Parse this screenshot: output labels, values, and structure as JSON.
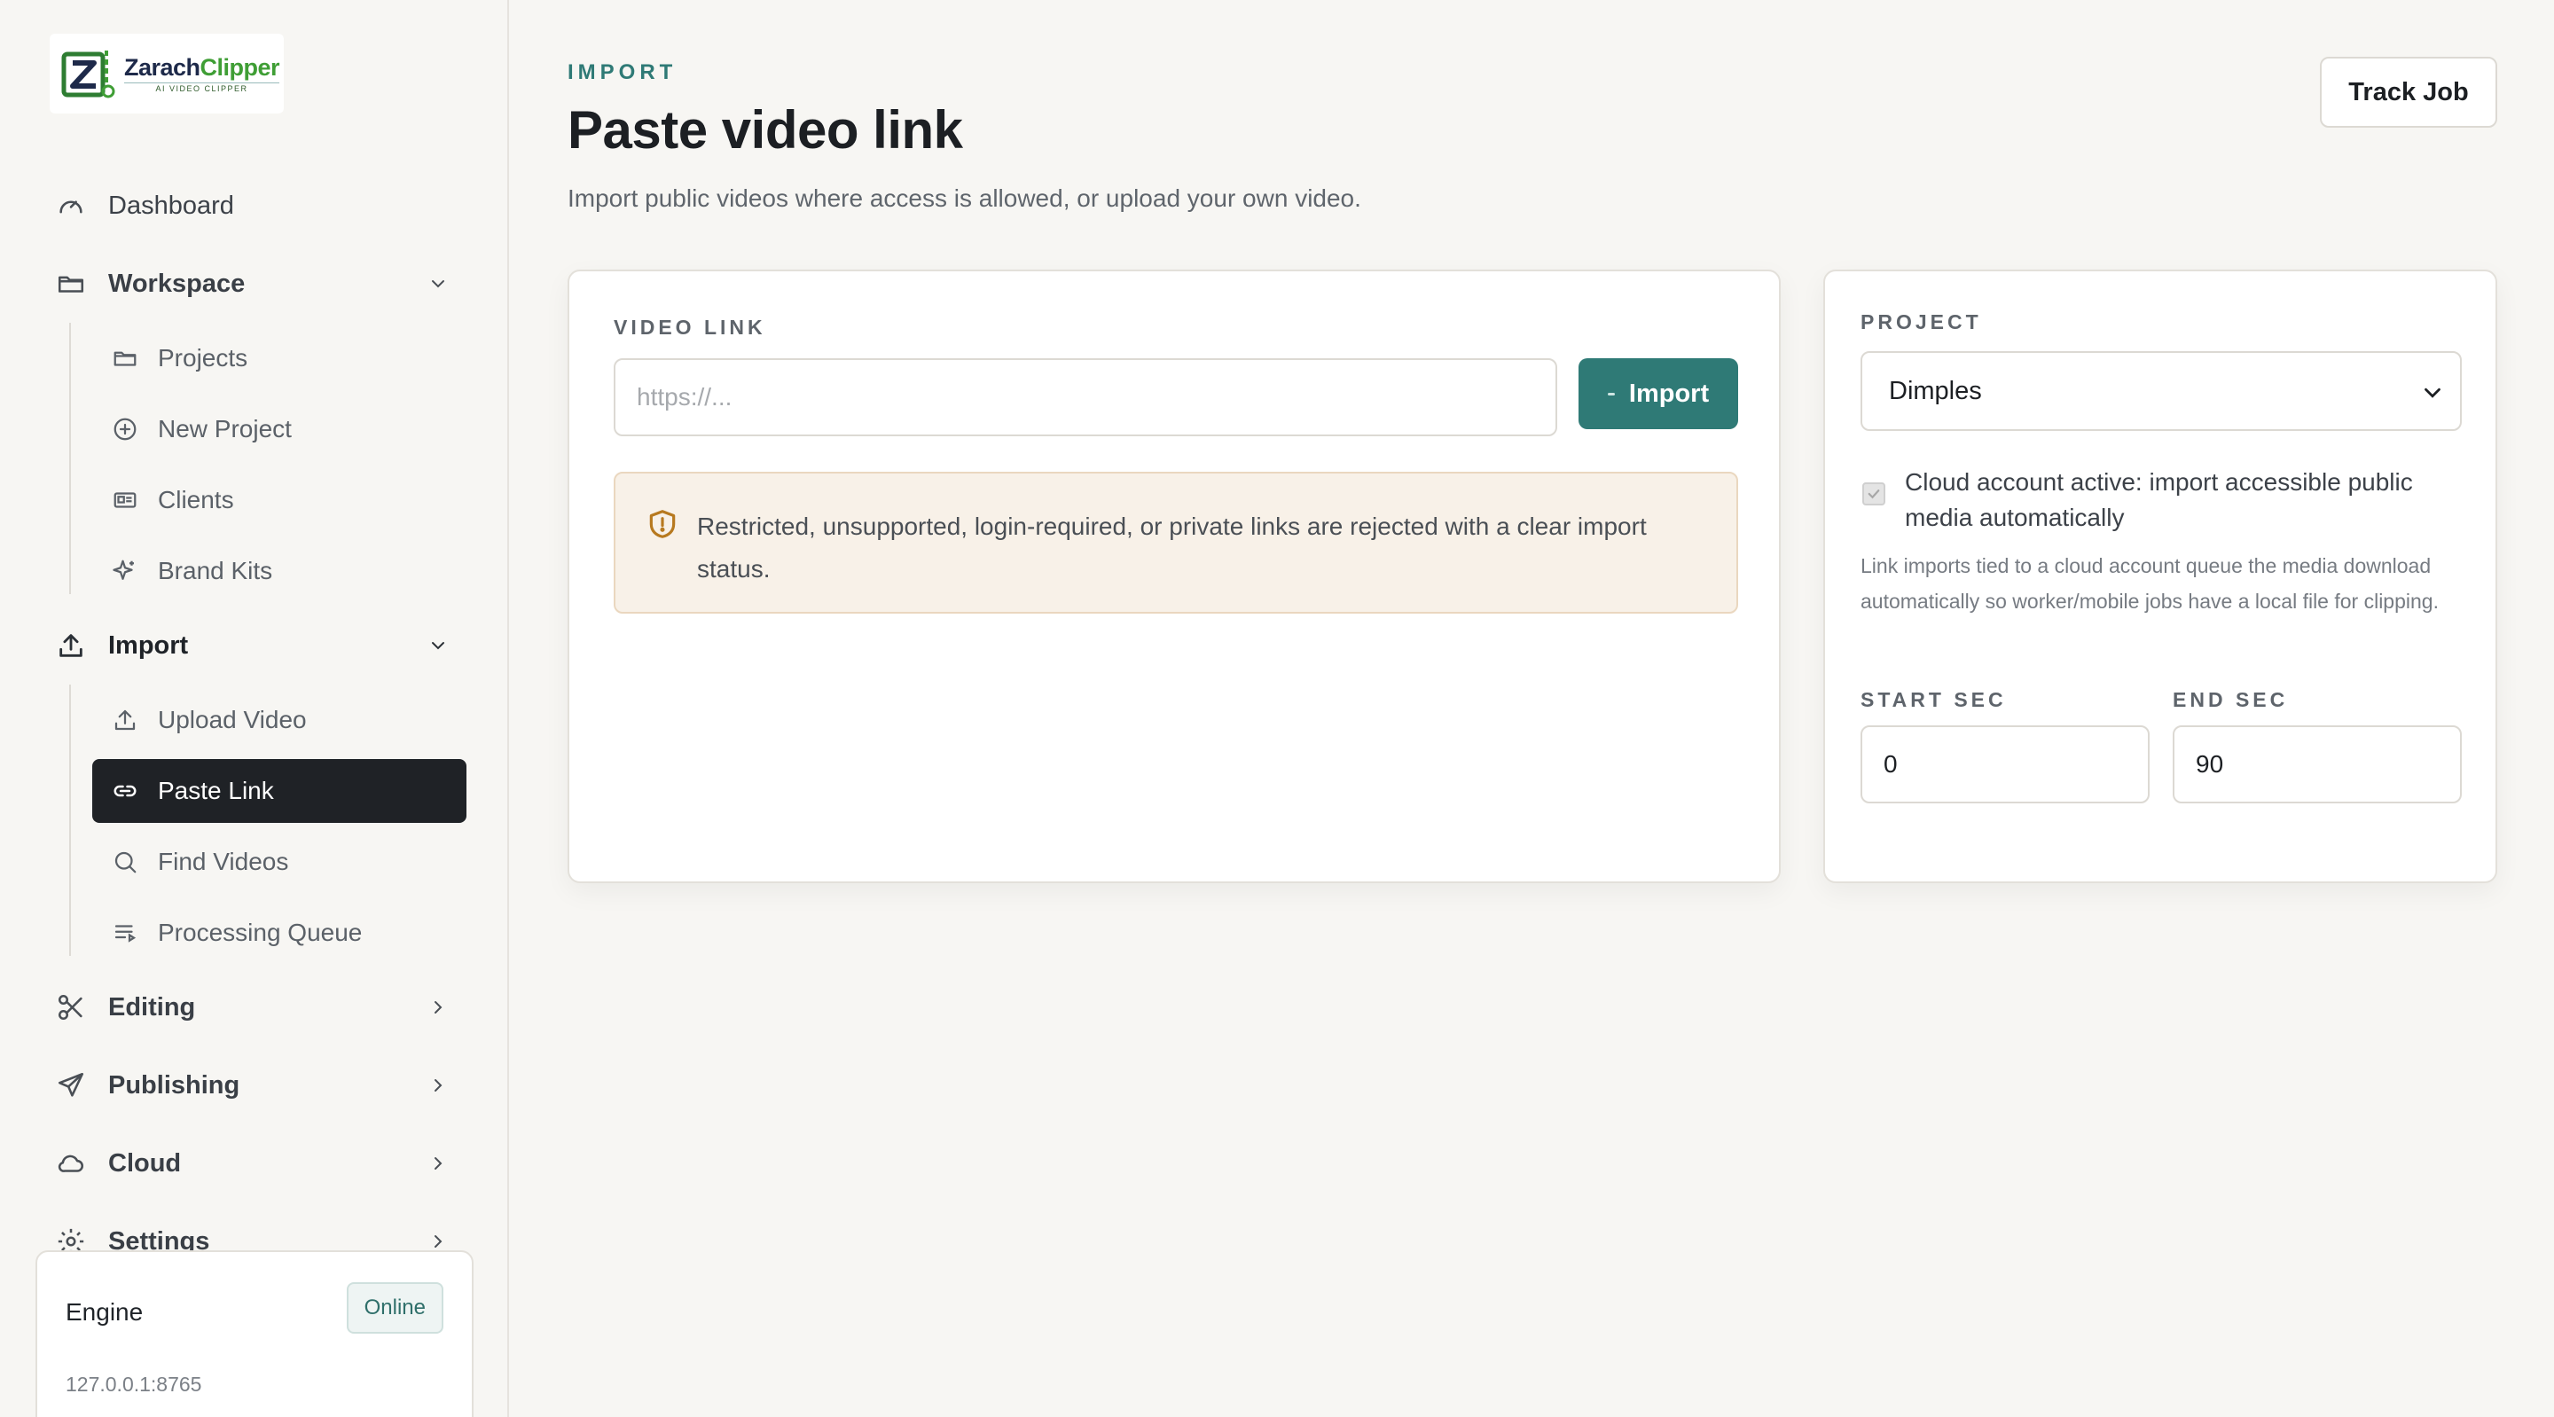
{
  "brand": {
    "name_part1": "Zarach",
    "name_part2": "Clipper",
    "tagline": "AI VIDEO CLIPPER"
  },
  "sidebar": {
    "items": [
      {
        "label": "Dashboard",
        "icon": "gauge-icon"
      },
      {
        "label": "Workspace",
        "icon": "folder-icon",
        "expanded": true,
        "children": [
          {
            "label": "Projects",
            "icon": "folder-icon"
          },
          {
            "label": "New Project",
            "icon": "plus-circle-icon"
          },
          {
            "label": "Clients",
            "icon": "id-card-icon"
          },
          {
            "label": "Brand Kits",
            "icon": "sparkle-icon"
          }
        ]
      },
      {
        "label": "Import",
        "icon": "upload-icon",
        "expanded": true,
        "children": [
          {
            "label": "Upload Video",
            "icon": "upload-icon"
          },
          {
            "label": "Paste Link",
            "icon": "link-icon",
            "active": true
          },
          {
            "label": "Find Videos",
            "icon": "search-icon"
          },
          {
            "label": "Processing Queue",
            "icon": "queue-list-icon"
          }
        ]
      },
      {
        "label": "Editing",
        "icon": "scissors-icon"
      },
      {
        "label": "Publishing",
        "icon": "send-icon"
      },
      {
        "label": "Cloud",
        "icon": "cloud-icon"
      },
      {
        "label": "Settings",
        "icon": "gear-icon"
      }
    ]
  },
  "engine": {
    "title": "Engine",
    "status": "Online",
    "address": "127.0.0.1:8765"
  },
  "header": {
    "eyebrow": "IMPORT",
    "title": "Paste video link",
    "subtitle": "Import public videos where access is allowed, or upload your own video.",
    "track_job_label": "Track Job"
  },
  "link_card": {
    "label": "VIDEO LINK",
    "placeholder": "https://...",
    "value": "",
    "import_label": "Import",
    "notice": "Restricted, unsupported, login-required, or private links are rejected with a clear import status."
  },
  "options_card": {
    "project_label": "PROJECT",
    "project_value": "Dimples",
    "cloud_checkbox_checked": true,
    "cloud_checkbox_label": "Cloud account active: import accessible public media automatically",
    "help_text": "Link imports tied to a cloud account queue the media download automatically so worker/mobile jobs have a local file for clipping.",
    "start_label": "START SEC",
    "start_value": "0",
    "end_label": "END SEC",
    "end_value": "90"
  },
  "colors": {
    "accent": "#2f7a76",
    "active_nav": "#1f2226",
    "notice_bg": "#f8f1e8",
    "notice_icon": "#b7791f",
    "background": "#f7f6f3"
  }
}
